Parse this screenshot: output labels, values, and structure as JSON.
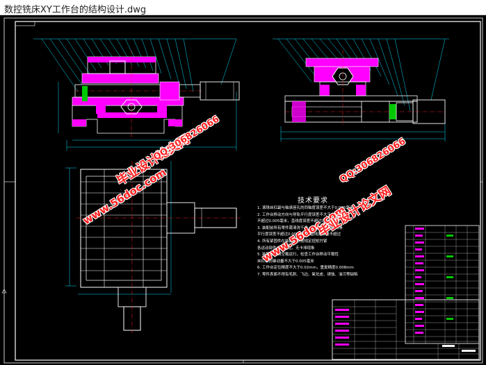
{
  "window": {
    "title": "数控铣床XY工作台的结构设计.dwg"
  },
  "drawing": {
    "tech_requirements_title": "技术要求",
    "tech_requirements": [
      "1. 滚珠丝杠副与轴承座孔的同轴度误差不大于0.005毫米",
      "2. 工作台移动方向与导轨平行度误差不大于0.003毫米",
      "   不超过0.005毫米，直线度误差不超过0.005毫米",
      "3. 装配前所有零件需清洗干净，轴承用润滑脂润滑",
      "   平行度误差不超过0.005毫米，直线度误差不超过",
      "4. 所有紧固件在装配时须按规定扭矩拧紧",
      "   各运动部件运转灵活，无卡滞现象",
      "5. 装配完成后空载运行，检查工作台移动平稳性",
      "   丝杠轴向窜动量不大于0.005毫米",
      "6. 工作台定位精度不大于0.02mm，重复精度0.008mm",
      "7. 零件表面不得有毛刺、飞边、氧化皮、锈蚀、油污等缺陷"
    ],
    "watermarks": {
      "brand": "毕业设计论文网",
      "site": "www.56doc.com",
      "qq": "QQ:306826066"
    }
  },
  "colors": {
    "background": "#000000",
    "frame": "#ffffff",
    "outline": "#ffffff",
    "section_fill": "#ff00ff",
    "hatch": "#ff00ff",
    "dimension": "#00e0ff",
    "leader": "#00e0ff",
    "centerline": "#ff2020",
    "green_part": "#00c800",
    "watermark": "#ff1e1e"
  }
}
